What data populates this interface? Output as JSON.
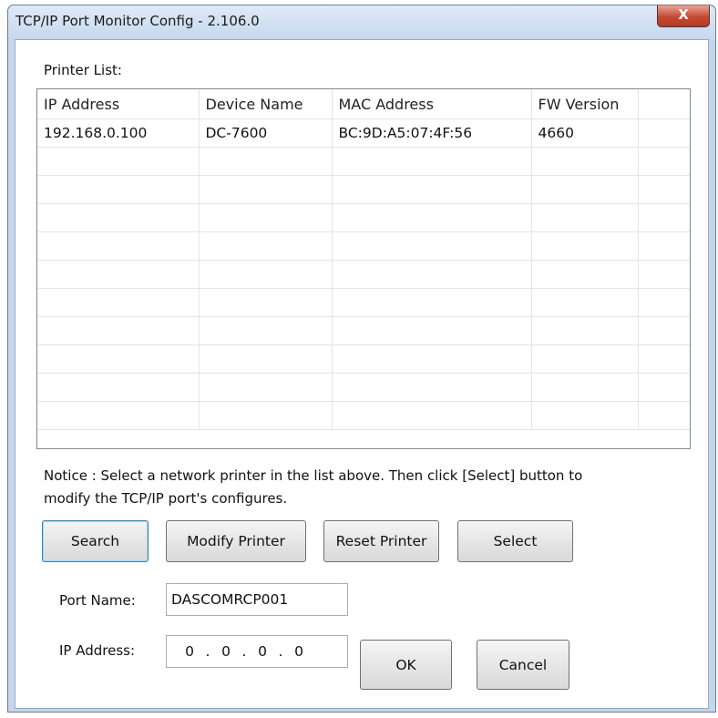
{
  "window": {
    "title": "TCP/IP Port Monitor Config - 2.106.0",
    "close_glyph": "X"
  },
  "printer_list": {
    "label": "Printer List:",
    "columns": [
      "IP Address",
      "Device Name",
      "MAC Address",
      "FW Version",
      ""
    ],
    "rows": [
      [
        "192.168.0.100",
        "DC-7600",
        "BC:9D:A5:07:4F:56",
        "4660",
        ""
      ]
    ],
    "empty_row_count": 10
  },
  "notice": {
    "line1": "Notice : Select a network printer in the list above. Then click [Select] button to",
    "line2": "modify the TCP/IP port's configures."
  },
  "buttons": {
    "search": "Search",
    "modify": "Modify Printer",
    "reset": "Reset Printer",
    "select": "Select",
    "ok": "OK",
    "cancel": "Cancel"
  },
  "port_name": {
    "label": "Port Name:",
    "value": "DASCOMRCP001"
  },
  "ip_address": {
    "label": "IP Address:",
    "octets": [
      "0",
      "0",
      "0",
      "0"
    ],
    "separator": "."
  }
}
